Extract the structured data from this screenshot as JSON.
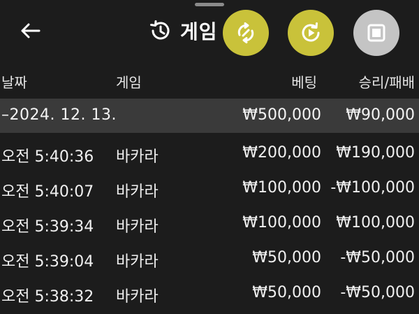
{
  "header": {
    "back_icon": "arrow-left-icon",
    "history_icon": "history-icon",
    "title_partial": "게임",
    "title_suffix": "",
    "fab_sync_icon": "sync-link-icon",
    "fab_replay_icon": "replay-play-icon",
    "fab_stop_icon": "stop-square-icon",
    "colors": {
      "fab_active": "#c9c23a",
      "fab_inactive": "#c4c4c4",
      "background": "#1c1c1c",
      "summary_bg": "#3a3a3a"
    }
  },
  "table": {
    "columns": {
      "date": "날짜",
      "game": "게임",
      "bet": "베팅",
      "result": "승리/패배"
    },
    "summary": {
      "date": "–2024. 12. 13.",
      "bet": "₩500,000",
      "result": "₩90,000"
    },
    "rows": [
      {
        "time": "오전 5:40:36",
        "game": "바카라",
        "bet": "₩200,000",
        "result": "₩190,000"
      },
      {
        "time": "오전 5:40:07",
        "game": "바카라",
        "bet": "₩100,000",
        "result": "-₩100,000"
      },
      {
        "time": "오전 5:39:34",
        "game": "바카라",
        "bet": "₩100,000",
        "result": "₩100,000"
      },
      {
        "time": "오전 5:39:04",
        "game": "바카라",
        "bet": "₩50,000",
        "result": "-₩50,000"
      },
      {
        "time": "오전 5:38:32",
        "game": "바카라",
        "bet": "₩50,000",
        "result": "-₩50,000"
      }
    ]
  }
}
